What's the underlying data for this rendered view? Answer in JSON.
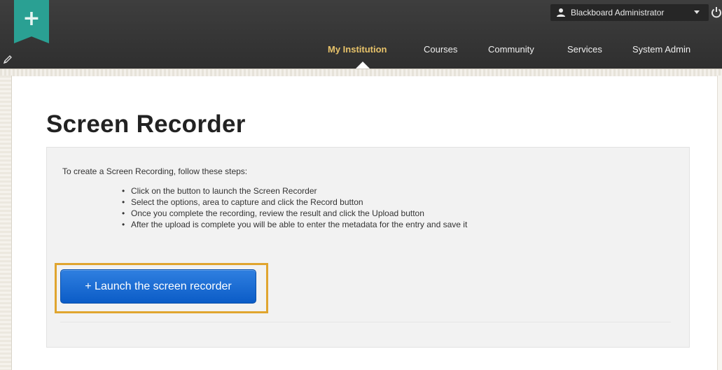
{
  "header": {
    "logo_icon": "plus-icon",
    "logo_glyph": "+",
    "edit_icon": "pencil-icon",
    "user": {
      "icon": "user-icon",
      "name": "Blackboard Administrator",
      "menu_icon": "chevron-down-icon"
    },
    "logout_icon": "power-icon",
    "nav": {
      "my_institution": "My Institution",
      "courses": "Courses",
      "community": "Community",
      "services": "Services",
      "system_admin": "System Admin"
    },
    "active_tab": "My Institution",
    "colors": {
      "header_bg": "#333333",
      "active_tab": "#e8c36a",
      "logo_tab": "#2aa093"
    }
  },
  "main": {
    "title": "Screen Recorder",
    "intro": "To create a Screen Recording, follow these steps:",
    "steps": [
      "Click on the button to launch the Screen Recorder",
      "Select the options, area to capture and click the Record button",
      "Once you complete the recording, review the result and click the Upload button",
      "After the upload is complete you will be able to enter the metadata for the entry and save it"
    ],
    "bullet": "•",
    "launch_button": "+ Launch the screen recorder",
    "colors": {
      "button": "#0b5cc7",
      "highlight_frame": "#e0a52f"
    }
  }
}
